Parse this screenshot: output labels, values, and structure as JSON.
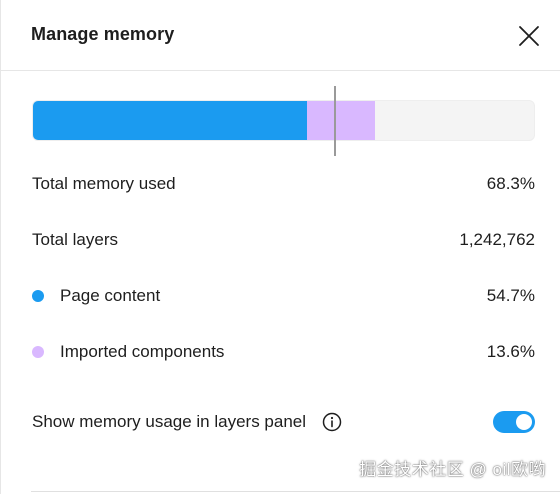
{
  "dialog": {
    "title": "Manage memory",
    "close_icon": "close-icon"
  },
  "memory_bar": {
    "page_content_fraction": 0.547,
    "imported_components_fraction": 0.136,
    "marker_fraction": 0.6,
    "colors": {
      "page_content": "#1b9bf0",
      "imported_components": "#d9b8ff",
      "track": "#f4f4f4"
    }
  },
  "stats": {
    "total_memory": {
      "label": "Total memory used",
      "value": "68.3%"
    },
    "total_layers": {
      "label": "Total layers",
      "value": "1,242,762"
    },
    "page_content": {
      "label": "Page content",
      "value": "54.7%",
      "color": "#1b9bf0"
    },
    "imported_components": {
      "label": "Imported components",
      "value": "13.6%",
      "color": "#d9b8ff"
    }
  },
  "setting": {
    "label": "Show memory usage in layers panel",
    "info_icon": "info-icon",
    "toggle_on": true,
    "toggle_color": "#1b9bf0"
  },
  "watermark": "掘金技术社区 @ oil欧哟"
}
